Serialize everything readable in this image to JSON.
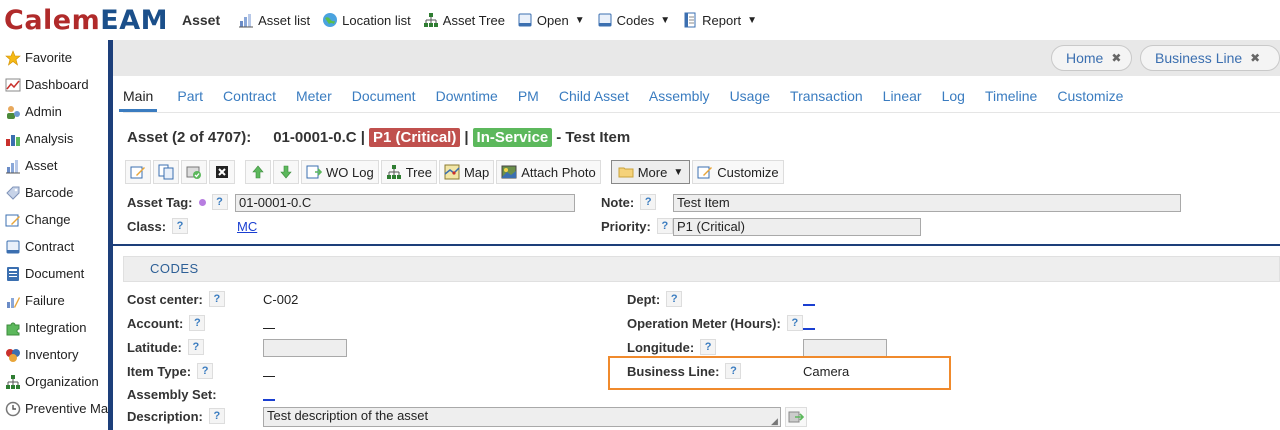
{
  "app": {
    "logo_part1": "Calem",
    "logo_part2": "EAM",
    "module": "Asset"
  },
  "topmenu": [
    {
      "label": "Asset list",
      "icon": "asset-list-icon",
      "dropdown": false
    },
    {
      "label": "Location list",
      "icon": "globe-icon",
      "dropdown": false
    },
    {
      "label": "Asset Tree",
      "icon": "tree-icon",
      "dropdown": false
    },
    {
      "label": "Open",
      "icon": "document-icon",
      "dropdown": true
    },
    {
      "label": "Codes",
      "icon": "document-icon",
      "dropdown": true
    },
    {
      "label": "Report",
      "icon": "report-icon",
      "dropdown": true
    }
  ],
  "sidebar": [
    {
      "label": "Favorite",
      "icon": "star-icon"
    },
    {
      "label": "Dashboard",
      "icon": "dashboard-icon"
    },
    {
      "label": "Admin",
      "icon": "admin-icon"
    },
    {
      "label": "Analysis",
      "icon": "chart-icon"
    },
    {
      "label": "Asset",
      "icon": "asset-icon"
    },
    {
      "label": "Barcode",
      "icon": "barcode-icon"
    },
    {
      "label": "Change",
      "icon": "change-icon"
    },
    {
      "label": "Contract",
      "icon": "contract-icon"
    },
    {
      "label": "Document",
      "icon": "document-icon"
    },
    {
      "label": "Failure",
      "icon": "failure-icon"
    },
    {
      "label": "Integration",
      "icon": "puzzle-icon"
    },
    {
      "label": "Inventory",
      "icon": "inventory-icon"
    },
    {
      "label": "Organization",
      "icon": "organization-icon"
    },
    {
      "label": "Preventive Ma",
      "icon": "clock-icon"
    }
  ],
  "open_tabs": [
    {
      "label": "Home",
      "close": "✖"
    },
    {
      "label": "Business Line",
      "close": "✖"
    }
  ],
  "subtabs": [
    "Main",
    "Part",
    "Contract",
    "Meter",
    "Document",
    "Downtime",
    "PM",
    "Child Asset",
    "Assembly",
    "Usage",
    "Transaction",
    "Linear",
    "Log",
    "Timeline",
    "Customize"
  ],
  "asset": {
    "position": "Asset (2 of 4707):",
    "id_sep": "01-0001-0.C |",
    "priority_badge": "P1 (Critical)",
    "sep": "|",
    "status_badge": "In-Service",
    "name": "- Test Item"
  },
  "toolbar": {
    "wo_log": "WO Log",
    "tree": "Tree",
    "map": "Map",
    "attach_photo": "Attach Photo",
    "more": "More",
    "customize": "Customize"
  },
  "header_fields": {
    "asset_tag_label": "Asset Tag:",
    "asset_tag_value": "01-0001-0.C",
    "class_label": "Class:",
    "class_value": "MC",
    "note_label": "Note:",
    "note_value": "Test Item",
    "priority_label": "Priority:",
    "priority_value": "P1 (Critical)"
  },
  "codes": {
    "section_title": "CODES",
    "cost_center_label": "Cost center:",
    "cost_center_value": "C-002",
    "account_label": "Account:",
    "latitude_label": "Latitude:",
    "item_type_label": "Item Type:",
    "assembly_set_label": "Assembly Set:",
    "description_label": "Description:",
    "description_value": "Test description of the asset",
    "dept_label": "Dept:",
    "operation_meter_label": "Operation Meter (Hours):",
    "longitude_label": "Longitude:",
    "business_line_label": "Business Line:",
    "business_line_value": "Camera"
  },
  "help_glyph": "?",
  "colors": {
    "brand_red": "#b02a2a",
    "brand_blue": "#1b4f8a",
    "link_blue": "#3a7cc0",
    "badge_red": "#c0504d",
    "badge_green": "#5cb85c",
    "highlight_orange": "#f08a2c"
  }
}
